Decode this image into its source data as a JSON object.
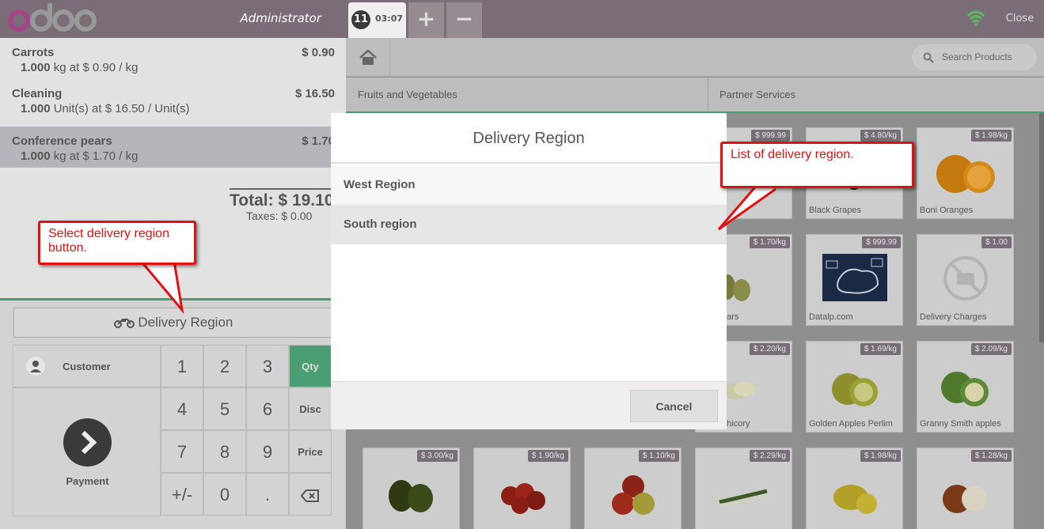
{
  "header": {
    "user": "Administrator",
    "order_number": "11",
    "order_time": "03:07",
    "add_label": "+",
    "remove_label": "−",
    "close_label": "Close"
  },
  "order": {
    "lines": [
      {
        "name": "Carrots",
        "price": "$ 0.90",
        "qty": "1.000",
        "detail": "kg at $ 0.90 / kg"
      },
      {
        "name": "Cleaning",
        "price": "$ 16.50",
        "qty": "1.000",
        "detail": "Unit(s) at $ 16.50 / Unit(s)"
      },
      {
        "name": "Conference pears",
        "price": "$ 1.70",
        "qty": "1.000",
        "detail": "kg at $ 1.70 / kg"
      }
    ],
    "total": "Total: $ 19.10",
    "taxes": "Taxes: $ 0.00"
  },
  "actions": {
    "delivery_region": "Delivery Region",
    "customer": "Customer",
    "payment": "Payment"
  },
  "keypad": {
    "keys": [
      "1",
      "2",
      "3",
      "4",
      "5",
      "6",
      "7",
      "8",
      "9",
      "+/-",
      "0",
      "."
    ],
    "modes": [
      "Qty",
      "Disc",
      "Price"
    ]
  },
  "products_panel": {
    "search_placeholder": "Search Products",
    "categories": [
      "Fruits and Vegetables",
      "Partner Services"
    ],
    "products": [
      {
        "name": "",
        "price": "$ 999.99"
      },
      {
        "name": "Black Grapes",
        "price": "$ 4.80/kg"
      },
      {
        "name": "Boni Oranges",
        "price": "$ 1.98/kg"
      },
      {
        "name": "ence pears",
        "price": "$ 1.70/kg"
      },
      {
        "name": "Datalp.com",
        "price": "$ 999.99"
      },
      {
        "name": "Delivery Charges",
        "price": "$ 1.00"
      },
      {
        "name": "andria chicory",
        "price": "$ 2.20/kg"
      },
      {
        "name": "Golden Apples Perlim",
        "price": "$ 1.69/kg"
      },
      {
        "name": "Granny Smith apples",
        "price": "$ 2.09/kg"
      },
      {
        "name": "",
        "price": "$ 3.00/kg"
      },
      {
        "name": "",
        "price": "$ 1.90/kg"
      },
      {
        "name": "",
        "price": "$ 1.10/kg"
      },
      {
        "name": "",
        "price": "$ 2.29/kg"
      },
      {
        "name": "",
        "price": "$ 1.98/kg"
      },
      {
        "name": "",
        "price": "$ 1.28/kg"
      }
    ]
  },
  "modal": {
    "title": "Delivery Region",
    "regions": [
      "West Region",
      "South region"
    ],
    "cancel": "Cancel"
  },
  "callouts": {
    "list_note": "List of delivery region.",
    "button_note": "Select delivery region button."
  },
  "colors": {
    "brand": "#7a6d77",
    "accent_green": "#4a9e74",
    "callout_red": "#e21111"
  }
}
